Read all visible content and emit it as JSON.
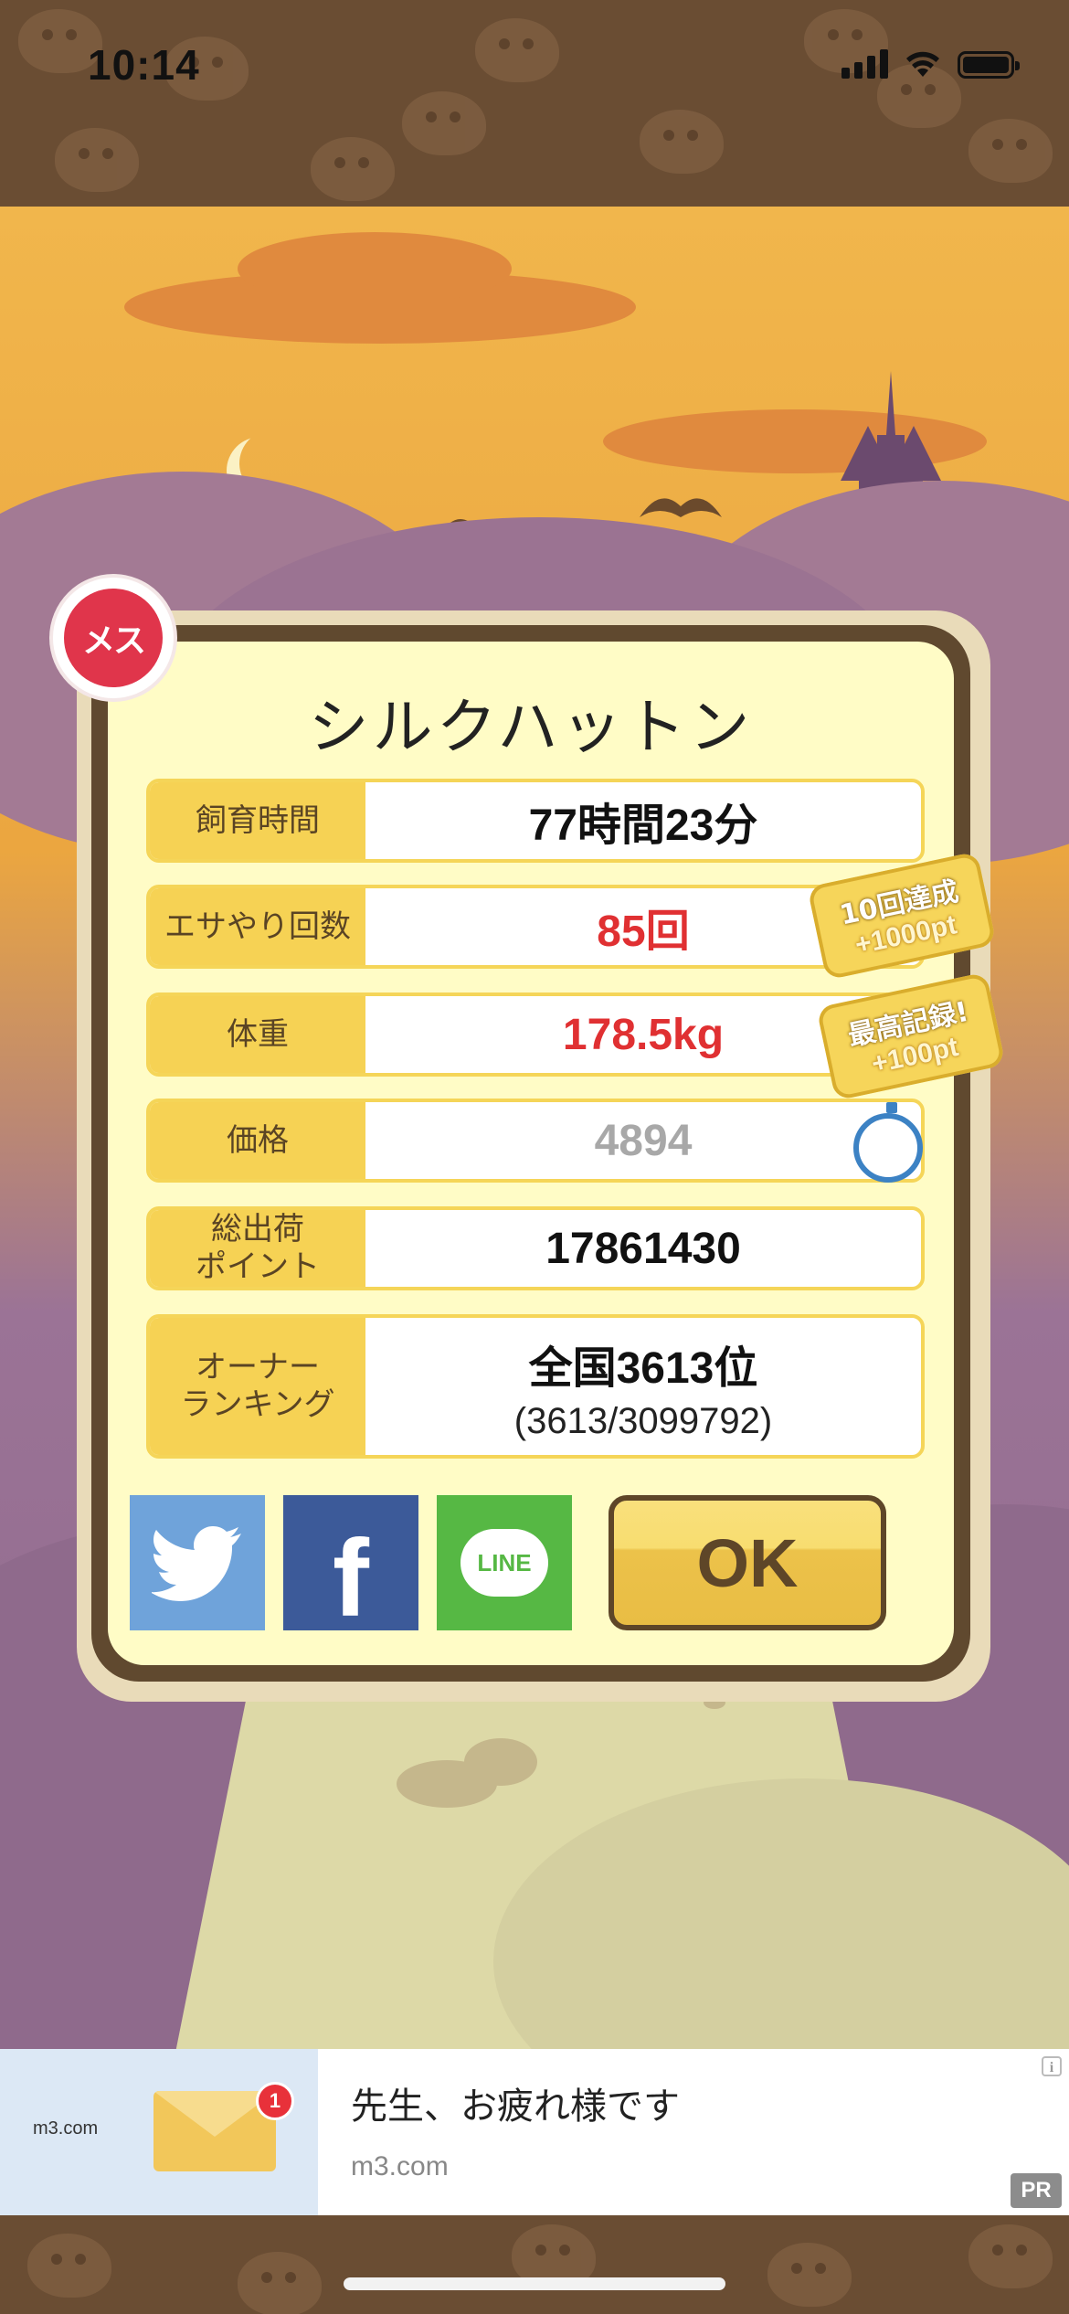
{
  "status_bar": {
    "time": "10:14"
  },
  "pet": {
    "name": "シルクハットン",
    "gender_badge": "メス",
    "gender_color": "#e0354b"
  },
  "stats": [
    {
      "label": "飼育時間",
      "value": "77時間23分",
      "style": "normal"
    },
    {
      "label": "エサやり回数",
      "value": "85回",
      "style": "red"
    },
    {
      "label": "体重",
      "value": "178.5kg",
      "style": "red"
    },
    {
      "label": "価格",
      "value": "4894",
      "style": "gray"
    },
    {
      "label": "総出荷\nポイント",
      "value": "17861430",
      "style": "normal"
    },
    {
      "label": "オーナー\nランキング",
      "value": "全国3613位",
      "sub": "(3613/3099792)",
      "style": "normal"
    }
  ],
  "achievements": [
    {
      "title": "10回達成",
      "bonus": "+1000pt"
    },
    {
      "title": "最高記録!",
      "bonus": "+100pt"
    }
  ],
  "share": {
    "twitter_icon": "twitter-bird-icon",
    "facebook_label": "f",
    "line_label": "LINE"
  },
  "ok_label": "OK",
  "ad": {
    "brand": "m3.com",
    "badge_count": "1",
    "title": "先生、お疲れ様です",
    "domain": "m3.com",
    "info": "i",
    "pr": "PR"
  },
  "colors": {
    "accent_yellow": "#f6d254",
    "red_value": "#e03032",
    "twitter": "#6fa3da",
    "facebook": "#3c5a99",
    "line": "#56b844"
  }
}
